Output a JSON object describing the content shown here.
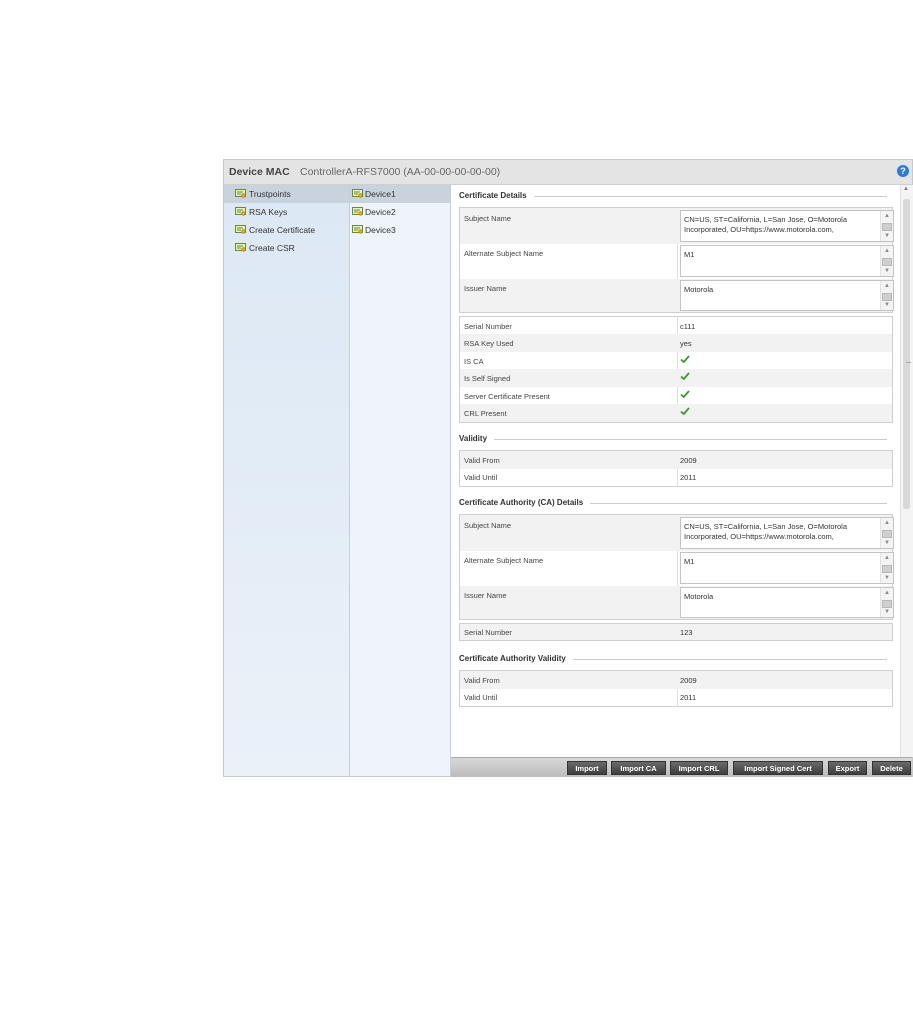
{
  "header": {
    "label": "Device MAC",
    "value": "ControllerA-RFS7000 (AA-00-00-00-00-00)",
    "help": "?"
  },
  "nav_primary": [
    {
      "label": "Trustpoints",
      "selected": true
    },
    {
      "label": "RSA Keys",
      "selected": false
    },
    {
      "label": "Create Certificate",
      "selected": false
    },
    {
      "label": "Create CSR",
      "selected": false
    }
  ],
  "nav_secondary": [
    {
      "label": "Device1",
      "selected": true
    },
    {
      "label": "Device2",
      "selected": false
    },
    {
      "label": "Device3",
      "selected": false
    }
  ],
  "certificate_details": {
    "title": "Certificate Details",
    "subject_name_label": "Subject Name",
    "subject_name_value": "CN=US, ST=California, L=San Jose, O=Motorola Incorporated, OU=https://www.motorola.com,",
    "alternate_subject_label": "Alternate Subject Name",
    "alternate_subject_value": "M1",
    "issuer_name_label": "Issuer Name",
    "issuer_name_value": "Motorola",
    "serial_number_label": "Serial Number",
    "serial_number_value": "c111",
    "rsa_key_label": "RSA Key Used",
    "rsa_key_value": "yes",
    "is_ca_label": "IS CA",
    "is_ca": true,
    "self_signed_label": "Is Self Signed",
    "self_signed": true,
    "server_cert_label": "Server Certificate Present",
    "server_cert": true,
    "crl_label": "CRL Present",
    "crl": true
  },
  "validity": {
    "title": "Validity",
    "from_label": "Valid From",
    "from_value": "2009",
    "until_label": "Valid Until",
    "until_value": "2011"
  },
  "ca_details": {
    "title": "Certificate Authority (CA) Details",
    "subject_name_label": "Subject Name",
    "subject_name_value": "CN=US, ST=California, L=San Jose, O=Motorola Incorporated, OU=https://www.motorola.com,",
    "alternate_subject_label": "Alternate Subject Name",
    "alternate_subject_value": "M1",
    "issuer_name_label": "Issuer Name",
    "issuer_name_value": "Motorola",
    "serial_number_label": "Serial Number",
    "serial_number_value": "123"
  },
  "ca_validity": {
    "title": "Certificate Authority Validity",
    "from_label": "Valid From",
    "from_value": "2009",
    "until_label": "Valid Until",
    "until_value": "2011"
  },
  "buttons": {
    "import": "Import",
    "import_ca": "Import CA",
    "import_crl": "Import CRL",
    "import_signed_cert": "Import Signed Cert",
    "export": "Export",
    "delete": "Delete"
  },
  "colors": {
    "check": "#3a9a2a",
    "help": "#2f7ad6"
  }
}
